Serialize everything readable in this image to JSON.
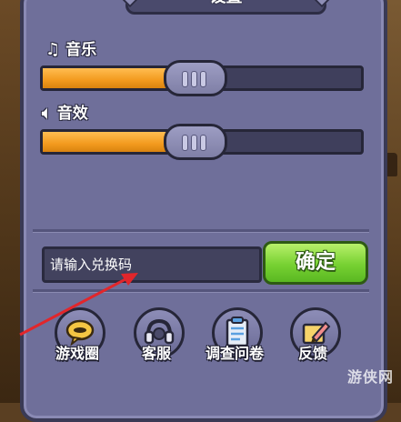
{
  "dialog": {
    "title": "设置"
  },
  "music": {
    "label": "音乐",
    "icon": "music-note-icon",
    "level_percent": 47
  },
  "sfx": {
    "label": "音效",
    "icon": "speaker-icon",
    "level_percent": 47
  },
  "redeem": {
    "placeholder": "请输入兑换码",
    "confirm_label": "确定"
  },
  "buttons": [
    {
      "label": "游戏圈",
      "icon": "chat-bubble-icon"
    },
    {
      "label": "客服",
      "icon": "headset-icon"
    },
    {
      "label": "调查问卷",
      "icon": "clipboard-icon"
    },
    {
      "label": "反馈",
      "icon": "pencil-note-icon"
    }
  ],
  "watermark": "游侠网",
  "colors": {
    "panel": "#6f6f9a",
    "slider_fill": "#f39a1e",
    "confirm": "#77d132",
    "arrow": "#e2262b"
  }
}
